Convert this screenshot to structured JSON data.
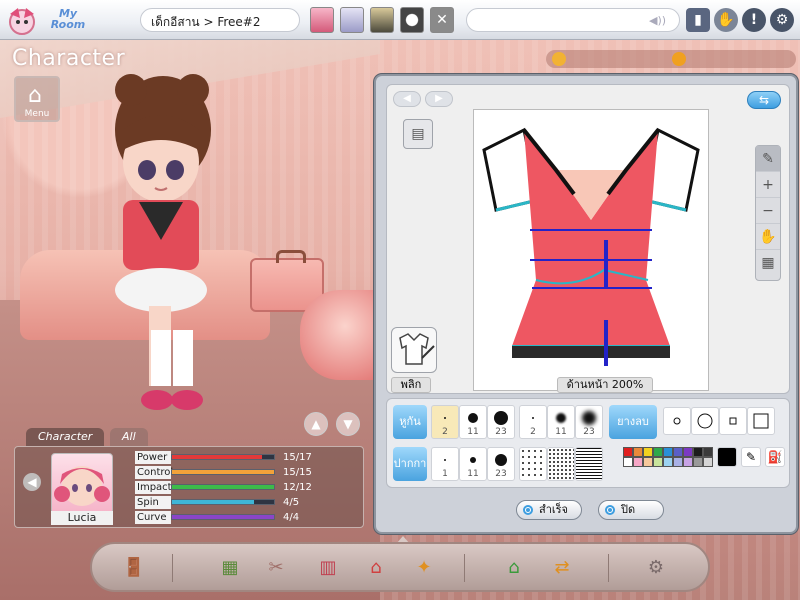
{
  "topbar": {
    "app_name": "My Room",
    "address": "เด็กอีสาน > Free#2",
    "icons": [
      "inbox-icon",
      "hands-icon",
      "help-icon",
      "settings-icon"
    ]
  },
  "scene": {
    "title": "Character",
    "menu_label": "Menu"
  },
  "editor": {
    "zoom_label": "ด้านหน้า 200%",
    "flip_label": "พลิก",
    "brush_label": "หูกัน",
    "eraser_label": "ยางลบ",
    "pen_label": "ปากกา",
    "brush_sizes": [
      "2",
      "11",
      "23",
      "2",
      "11",
      "23"
    ],
    "pen_sizes": [
      "1",
      "11",
      "23"
    ],
    "palette": [
      "#e01f1f",
      "#e9893a",
      "#f2d21f",
      "#2ea84a",
      "#2a8fd6",
      "#5a5fc7",
      "#7b39c2",
      "#1c1c1c",
      "#3b3b3b",
      "#ffffff",
      "#f6a6c6",
      "#f7c89b",
      "#c8e49c",
      "#9cd3f1",
      "#a9b1e6",
      "#c8a3e6",
      "#9a9a9a",
      "#d5d5d5"
    ],
    "current_color": "#000000",
    "done_label": "สำเร็จ",
    "close_label": "ปิด"
  },
  "stats": {
    "tab_character": "Character",
    "tab_all": "All",
    "name": "Lucia",
    "rows": [
      {
        "label": "Power",
        "value": "15/17",
        "fill": 0.88,
        "color": "#e23a3a"
      },
      {
        "label": "Control",
        "value": "15/15",
        "fill": 1.0,
        "color": "#f2a23a"
      },
      {
        "label": "Impact",
        "value": "12/12",
        "fill": 1.0,
        "color": "#3dbb4a"
      },
      {
        "label": "Spin",
        "value": "4/5",
        "fill": 0.8,
        "color": "#3fb6d6"
      },
      {
        "label": "Curve",
        "value": "4/4",
        "fill": 1.0,
        "color": "#8a45c8"
      }
    ]
  },
  "dock": {
    "icons": [
      "door-icon",
      "shop-icon",
      "scissors-icon",
      "wardrobe-icon",
      "house-icon",
      "gift-icon",
      "visit-house-icon",
      "swap-house-icon",
      "settings-box-icon"
    ]
  }
}
